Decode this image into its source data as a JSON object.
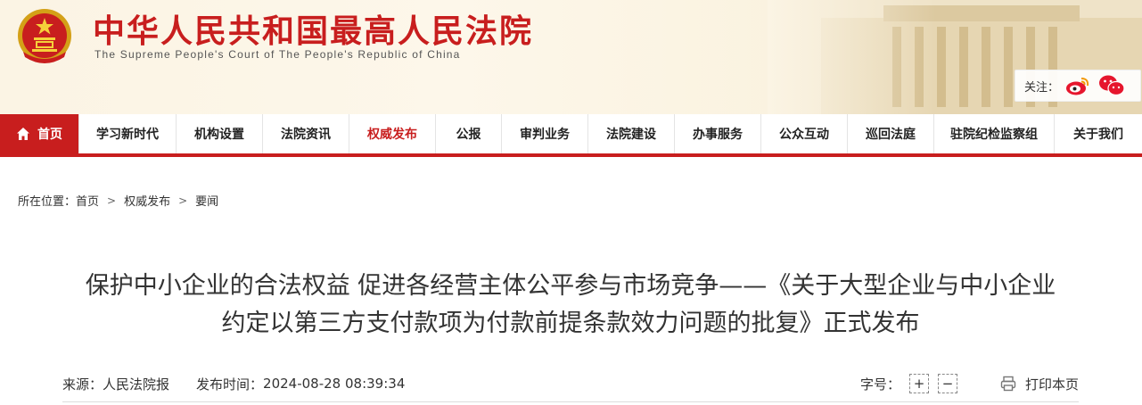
{
  "header": {
    "title": "中华人民共和国最高人民法院",
    "subtitle": "The Supreme People's Court of The People's Republic of China",
    "follow_label": "关注："
  },
  "nav": {
    "items": [
      {
        "label": "首页"
      },
      {
        "label": "学习新时代"
      },
      {
        "label": "机构设置"
      },
      {
        "label": "法院资讯"
      },
      {
        "label": "权威发布"
      },
      {
        "label": "公报"
      },
      {
        "label": "审判业务"
      },
      {
        "label": "法院建设"
      },
      {
        "label": "办事服务"
      },
      {
        "label": "公众互动"
      },
      {
        "label": "巡回法庭"
      },
      {
        "label": "驻院纪检监察组"
      },
      {
        "label": "关于我们"
      }
    ],
    "active": "权威发布"
  },
  "breadcrumb": {
    "prefix": "所在位置：",
    "items": [
      "首页",
      "权威发布",
      "要闻"
    ],
    "separator": ">"
  },
  "article": {
    "title_line1": "保护中小企业的合法权益 促进各经营主体公平参与市场竞争——《关于大型企业与中小企业",
    "title_line2": "约定以第三方支付款项为付款前提条款效力问题的批复》正式发布",
    "source_label": "来源：",
    "source": "人民法院报",
    "time_label": "发布时间：",
    "time": "2024-08-28 08:39:34",
    "font_size_label": "字号：",
    "increase_label": "+",
    "decrease_label": "−",
    "print_label": "打印本页"
  },
  "colors": {
    "brand_red": "#c81e1e",
    "header_bg": "#fbf4e4"
  },
  "icons": [
    "national-emblem-icon",
    "weibo-icon",
    "wechat-icon",
    "home-icon",
    "print-icon"
  ]
}
